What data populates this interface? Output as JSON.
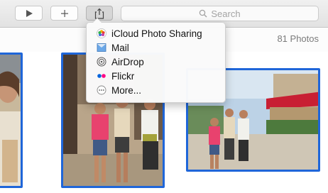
{
  "toolbar": {
    "play_icon": "play-icon",
    "add_icon": "plus-icon",
    "share_icon": "share-icon",
    "search": {
      "placeholder": "Search",
      "icon": "search-icon"
    }
  },
  "status": {
    "photo_count": "81 Photos"
  },
  "share_menu": {
    "items": [
      {
        "label": "iCloud Photo Sharing",
        "icon": "icloud-photo-sharing-icon"
      },
      {
        "label": "Mail",
        "icon": "mail-icon"
      },
      {
        "label": "AirDrop",
        "icon": "airdrop-icon"
      },
      {
        "label": "Flickr",
        "icon": "flickr-icon"
      },
      {
        "label": "More...",
        "icon": "more-icon"
      }
    ]
  },
  "colors": {
    "selection": "#1f66d9",
    "flickr_blue": "#0063dc",
    "flickr_pink": "#ff0084"
  }
}
